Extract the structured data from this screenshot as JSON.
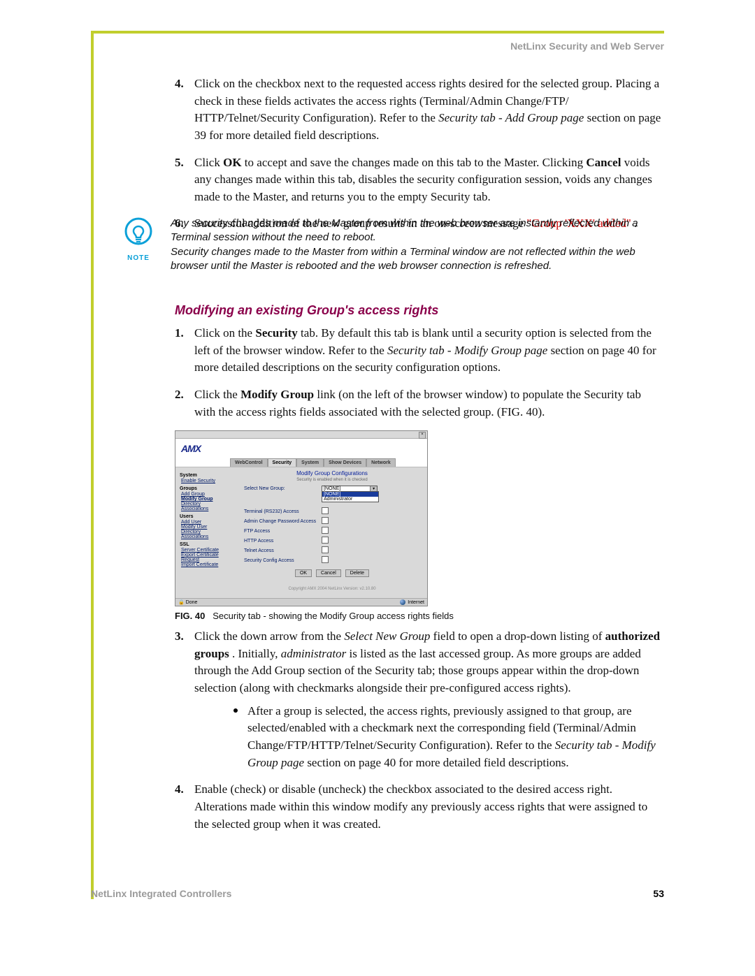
{
  "header": {
    "right": "NetLinx Security and Web Server"
  },
  "footer": {
    "left": "NetLinx Integrated Controllers",
    "page": "53"
  },
  "steps_a": {
    "n4": "4.",
    "t4a": "Click on the checkbox next to the requested access rights desired for the selected group. Placing a check in these fields activates the access rights (Terminal/Admin Change/FTP/ HTTP/Telnet/Security Configuration). Refer to the ",
    "t4i": "Security tab - Add Group page",
    "t4b": " section on page 39 for more detailed field descriptions.",
    "n5": "5.",
    "t5a": "Click ",
    "t5ok": "OK",
    "t5b": " to accept and save the changes made on this tab to the Master. Clicking ",
    "t5cancel": "Cancel",
    "t5c": " voids any changes made within this tab, disables the security configuration session, voids any changes made to the Master, and returns you to the empty Security tab.",
    "n6": "6.",
    "t6a": "Successful addition of the new group results in an on-screen message ",
    "t6r": "\"Group 'XXX' added\"",
    "t6b": "."
  },
  "note": {
    "label": "NOTE",
    "p1": "Any security changes made to the Master from within the web browser are instantly reflected within a Terminal session without the need to reboot.",
    "p2": "Security changes made to the Master from within a Terminal window are not reflected within the web browser until the Master is rebooted and the web browser connection is refreshed."
  },
  "subhead": "Modifying an existing Group's access rights",
  "steps_b": {
    "n1": "1.",
    "t1a": "Click on the ",
    "t1sec": "Security",
    "t1b": " tab. By default this tab is blank until a security option is selected from the left of the browser window. Refer to the ",
    "t1i": "Security tab - Modify Group page",
    "t1c": " section on page 40 for more detailed descriptions on the security configuration options.",
    "n2": "2.",
    "t2a": "Click the ",
    "t2mg": "Modify Group",
    "t2b": " link (on the left of the browser window) to populate the Security tab with the access rights fields associated with the selected group. (FIG. 40).",
    "n3": "3.",
    "t3a": "Click the down arrow from the ",
    "t3i": "Select New Group",
    "t3b": " field to open a drop-down listing of ",
    "t3ag": "authorized groups",
    "t3c": ". Initially, ",
    "t3adm": "administrator",
    "t3d": " is listed as the last accessed group. As more groups are added through the Add Group section of the Security tab; those groups appear within the drop-down selection (along with checkmarks alongside their pre-configured access rights).",
    "bul1a": "After a group is selected, the access rights, previously assigned to that group, are selected/enabled with a checkmark next the corresponding field (Terminal/Admin Change/FTP/HTTP/Telnet/Security Configuration). Refer to the ",
    "bul1i": "Security tab - Modify Group page",
    "bul1b": " section on page 40 for more detailed field descriptions.",
    "n4": "4.",
    "t4": "Enable (check) or disable (uncheck) the checkbox associated to the desired access right. Alterations made within this window modify any previously access rights that were assigned to the selected group when it was created."
  },
  "figure": {
    "caption_label": "FIG. 40",
    "caption_text": "Security tab - showing the Modify Group access rights fields",
    "logo": "AMX",
    "tabs": [
      "WebControl",
      "Security",
      "System",
      "Show Devices",
      "Network"
    ],
    "side": {
      "system_h": "System",
      "enable": "Enable Security",
      "groups_h": "Groups",
      "add_group": "Add Group",
      "modify_group": "Modify Group",
      "directory": "Directory",
      "associations": "Associations",
      "users_h": "Users",
      "add_user": "Add User",
      "modify_user": "Modify User",
      "directory2": "Directory",
      "associations2": "Associations",
      "ssl_h": "SSL",
      "server_cert": "Server Certificate",
      "export_cert": "Export Certificate",
      "request": "Request",
      "import_cert": "Import Certificate"
    },
    "pane": {
      "title": "Modify Group Configurations",
      "hint": "Security is enabled when it is checked",
      "select_label": "Select New Group:",
      "select_value": "[NONE]",
      "opt_hi": "[NONE]",
      "opt_admin": "Administrator",
      "rows": [
        "Terminal (RS232) Access",
        "Admin Change Password Access",
        "FTP Access",
        "HTTP Access",
        "Telnet Access",
        "Security Config Access"
      ],
      "btn_ok": "OK",
      "btn_cancel": "Cancel",
      "btn_delete": "Delete",
      "copyright": "Copyright AMX 2004   NetLinx Version: v2.10.80"
    },
    "status_done": "Done",
    "status_inet": "Internet"
  }
}
